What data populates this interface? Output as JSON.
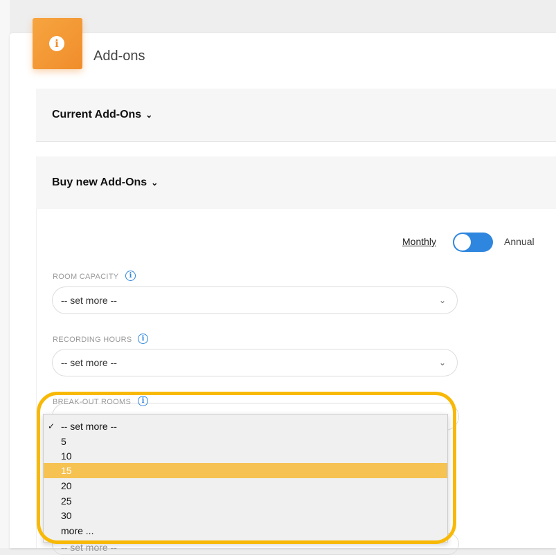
{
  "header": {
    "title": "Add-ons"
  },
  "sections": {
    "current": {
      "label": "Current Add-Ons"
    },
    "buy": {
      "label": "Buy new Add-Ons"
    }
  },
  "billing": {
    "monthly_label": "Monthly",
    "annual_label": "Annual",
    "toggle_state": "monthly"
  },
  "fields": {
    "room_capacity": {
      "label": "ROOM CAPACITY",
      "value": "-- set more --"
    },
    "recording_hours": {
      "label": "RECORDING HOURS",
      "value": "-- set more --"
    },
    "breakout_rooms": {
      "label": "BREAK-OUT ROOMS",
      "value": "-- set more --"
    }
  },
  "dropdown": {
    "options": [
      {
        "label": "-- set more --",
        "checked": true
      },
      {
        "label": "5"
      },
      {
        "label": "10"
      },
      {
        "label": "15",
        "highlighted": true
      },
      {
        "label": "20"
      },
      {
        "label": "25"
      },
      {
        "label": "30"
      },
      {
        "label": "more ..."
      }
    ]
  },
  "colors": {
    "accent_orange": "#f08d2b",
    "toggle_blue": "#2e86de",
    "highlight_ring": "#f8b906",
    "option_highlight": "#f6c252"
  }
}
